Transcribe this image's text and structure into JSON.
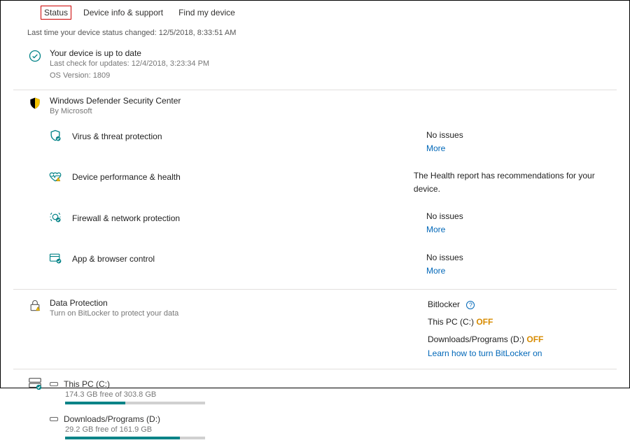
{
  "tabs": {
    "status": "Status",
    "deviceinfo": "Device info & support",
    "find": "Find my device"
  },
  "status_changed": "Last time your device status changed: 12/5/2018, 8:33:51 AM",
  "uptodate": {
    "title": "Your device is up to date",
    "lastcheck": "Last check for updates: 12/4/2018, 3:23:34 PM",
    "osversion": "OS Version: 1809"
  },
  "defender": {
    "title": "Windows Defender Security Center",
    "by": "By Microsoft",
    "items": {
      "virus": {
        "label": "Virus & threat protection",
        "status": "No issues",
        "more": "More"
      },
      "perf": {
        "label": "Device performance & health",
        "status": "The Health report has recommendations for your device."
      },
      "fw": {
        "label": "Firewall & network protection",
        "status": "No issues",
        "more": "More"
      },
      "app": {
        "label": "App & browser control",
        "status": "No issues",
        "more": "More"
      }
    }
  },
  "dataprotection": {
    "title": "Data Protection",
    "sub": "Turn on BitLocker to protect your data",
    "right_title": "Bitlocker",
    "drive_c_label": "This PC (C:) ",
    "drive_c_state": "OFF",
    "drive_d_label": "Downloads/Programs (D:) ",
    "drive_d_state": "OFF",
    "learn": "Learn how to turn BitLocker on"
  },
  "drives": {
    "c": {
      "name": "This PC (C:)",
      "free": "174.3 GB free of 303.8 GB",
      "pct": 43
    },
    "d": {
      "name": "Downloads/Programs (D:)",
      "free": "29.2 GB free of 161.9 GB",
      "pct": 82
    }
  }
}
